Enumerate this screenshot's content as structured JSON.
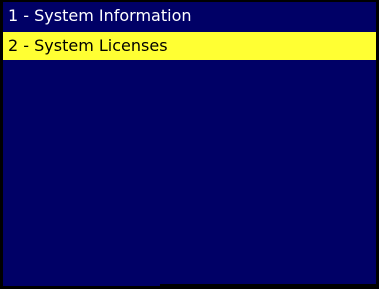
{
  "menu": {
    "items": [
      {
        "label": "1 - System Information",
        "selected": false
      },
      {
        "label": "2 - System Licenses",
        "selected": true
      }
    ]
  },
  "colors": {
    "background": "#000066",
    "selected_background": "#ffff33",
    "text": "#ffffff",
    "selected_text": "#000000",
    "border": "#000000"
  }
}
